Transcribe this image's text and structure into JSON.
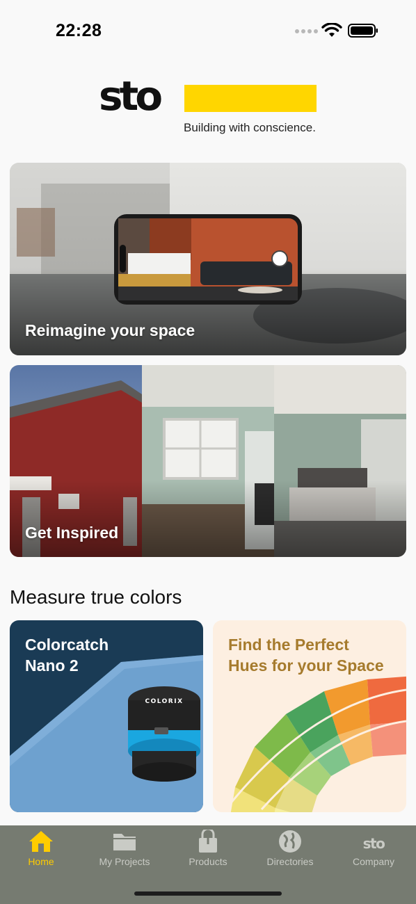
{
  "status_bar": {
    "time": "22:28"
  },
  "logo": {
    "brand": "sto",
    "tagline": "Building with conscience."
  },
  "cards": {
    "reimagine": {
      "title": "Reimagine your space"
    },
    "inspired": {
      "title": "Get Inspired"
    }
  },
  "measure": {
    "section_title": "Measure true colors",
    "tiles": [
      {
        "title_line1": "Colorcatch",
        "title_line2": "Nano 2",
        "device_brand": "COLORIX"
      },
      {
        "title_line1": "Find the Perfect",
        "title_line2": "Hues for your Space"
      }
    ]
  },
  "tab_bar": {
    "tabs": [
      {
        "label": "Home",
        "icon": "home-icon",
        "active": true
      },
      {
        "label": "My Projects",
        "icon": "folder-icon",
        "active": false
      },
      {
        "label": "Products",
        "icon": "paint-bucket-icon",
        "active": false
      },
      {
        "label": "Directories",
        "icon": "globe-icon",
        "active": false
      },
      {
        "label": "Company",
        "icon": "sto-logo-icon",
        "active": false
      }
    ]
  },
  "colors": {
    "accent": "#ffcc00",
    "logo_yellow": "#ffd600",
    "tab_bar_bg": "#767b71",
    "nano_tile_bg": "#1a3b55",
    "hues_tile_bg": "#fdefe1",
    "hues_title": "#a67b2d"
  }
}
